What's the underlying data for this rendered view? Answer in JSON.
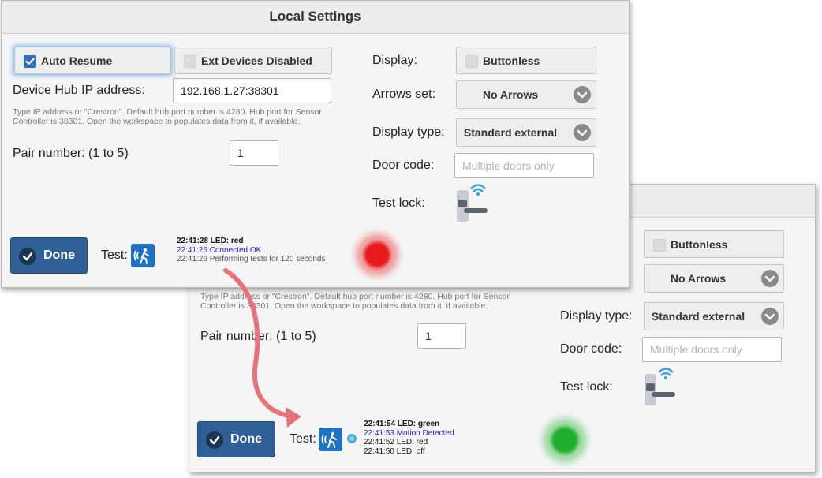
{
  "front": {
    "title": "Local Settings",
    "auto_resume": {
      "label": "Auto Resume",
      "checked": true
    },
    "ext_devices": {
      "label": "Ext Devices Disabled",
      "checked": false
    },
    "hub_ip_label": "Device Hub IP address:",
    "hub_ip_value": "192.168.1.27:38301",
    "hint": "Type IP address or \"Crestron\". Default hub port number is 4280. Hub port for Sensor Controller is 38301. Open the workspace to populates data from it, if available.",
    "pair_label": "Pair number: (1 to 5)",
    "pair_value": "1",
    "display_label": "Display:",
    "buttonless": {
      "label": "Buttonless",
      "checked": false
    },
    "arrows_label": "Arrows set:",
    "arrows_value": "No Arrows",
    "display_type_label": "Display type:",
    "display_type_value": "Standard external",
    "door_code_label": "Door code:",
    "door_code_placeholder": "Multiple doors only",
    "test_lock_label": "Test lock:",
    "done_label": "Done",
    "test_label": "Test:",
    "log": [
      {
        "text": "22:41:28 LED: red",
        "color": "#111111",
        "bold": true
      },
      {
        "text": "22:41:26 Connected OK",
        "color": "#1a1ad6",
        "bold": false
      },
      {
        "text": "22:41:26 Performing tests for 120 seconds",
        "color": "#555555",
        "bold": false
      }
    ],
    "led_color": "#e8191c"
  },
  "back": {
    "hint": "Type IP address or \"Crestron\". Default hub port number is 4280. Hub port for Sensor Controller is 38301. Open the workspace to populates data from it, if available.",
    "pair_label": "Pair number: (1 to 5)",
    "pair_value": "1",
    "buttonless": {
      "label": "Buttonless",
      "checked": false
    },
    "arrows_value": "No Arrows",
    "display_type_label": "Display type:",
    "display_type_value": "Standard external",
    "door_code_label": "Door code:",
    "door_code_placeholder": "Multiple doors only",
    "test_lock_label": "Test lock:",
    "done_label": "Done",
    "test_label": "Test:",
    "log": [
      {
        "text": "22:41:54 LED: green",
        "color": "#111111",
        "bold": true
      },
      {
        "text": "22:41:53 Motion Detected",
        "color": "#1a1ad6",
        "bold": false
      },
      {
        "text": "22:41:52 LED: red",
        "color": "#111111",
        "bold": false
      },
      {
        "text": "22:41:50 LED: off",
        "color": "#111111",
        "bold": false
      }
    ],
    "led_color": "#1fb02f"
  },
  "arrow_color": "#e8727a"
}
